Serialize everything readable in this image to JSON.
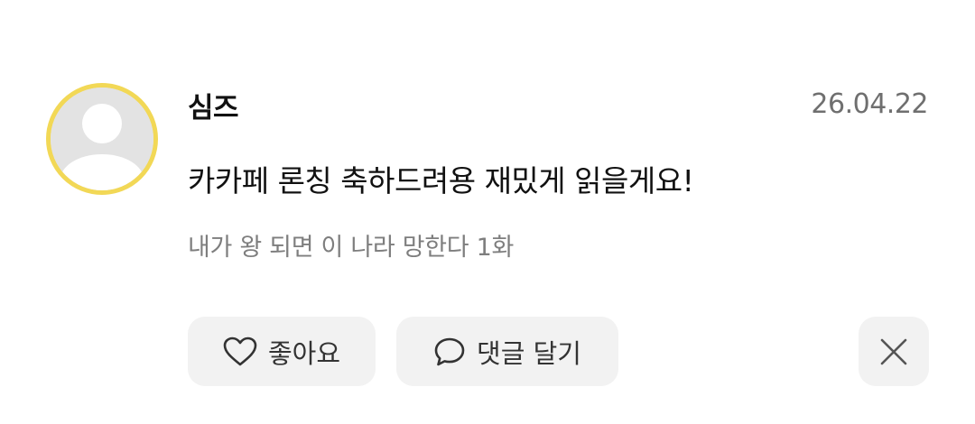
{
  "comment": {
    "author": "심즈",
    "date": "26.04.22",
    "text": "카카페 론칭 축하드려용 재밌게 읽을게요!",
    "episode": "내가 왕 되면 이 나라 망한다 1화"
  },
  "actions": {
    "like_label": "좋아요",
    "reply_label": "댓글 달기",
    "like_icon": "heart-outline-icon",
    "reply_icon": "speech-bubble-icon",
    "close_icon": "close-icon"
  },
  "colors": {
    "avatar_ring": "#f2d856",
    "avatar_bg": "#e3e3e3",
    "button_bg": "#f2f2f2",
    "secondary_text": "#7e7e7e"
  }
}
